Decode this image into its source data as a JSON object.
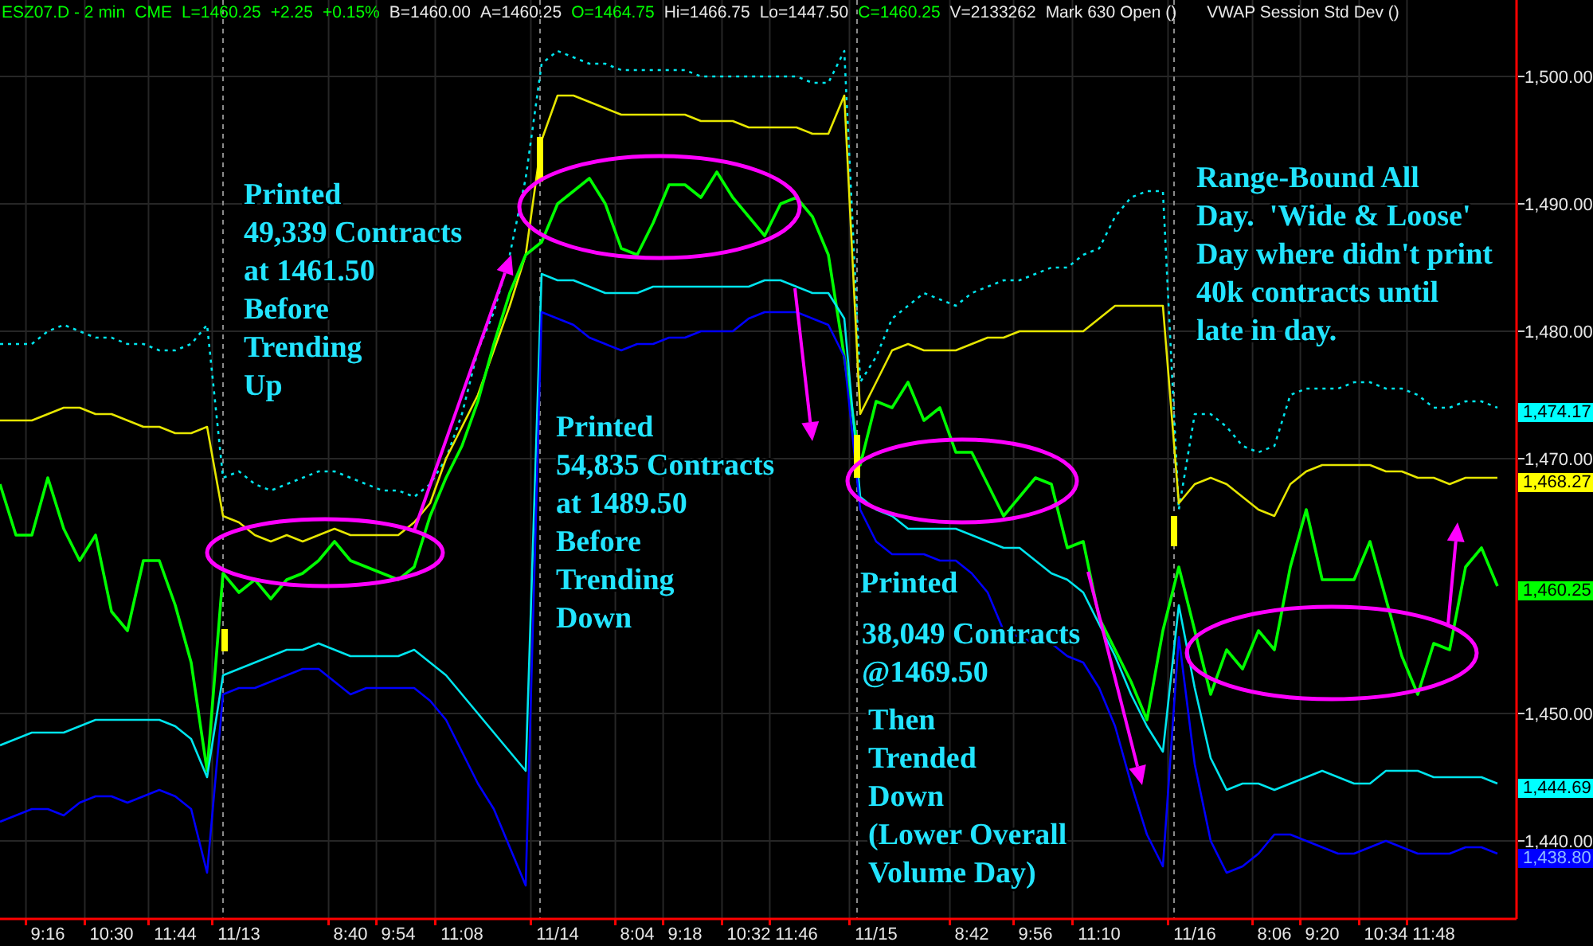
{
  "header": {
    "quote": [
      {
        "text": "ESZ07.D - 2 min",
        "color": "#00ff00"
      },
      {
        "text": "CME",
        "color": "#00ff00"
      },
      {
        "text": "L=1460.25",
        "color": "#00ff00"
      },
      {
        "text": "+2.25",
        "color": "#00ff00"
      },
      {
        "text": "+0.15%",
        "color": "#00ff00"
      },
      {
        "text": "B=1460.00",
        "color": "#e8e8e8"
      },
      {
        "text": "A=1460.25",
        "color": "#e8e8e8"
      },
      {
        "text": "O=1464.75",
        "color": "#00ff00"
      },
      {
        "text": "Hi=1466.75",
        "color": "#e8e8e8"
      },
      {
        "text": "Lo=1447.50",
        "color": "#e8e8e8"
      },
      {
        "text": "C=1460.25",
        "color": "#00ff00"
      },
      {
        "text": "V=2133262",
        "color": "#e8e8e8"
      },
      {
        "text": "Mark 630 Open ()",
        "color": "#e8e8e8"
      }
    ],
    "study": "VWAP Session Std Dev ()"
  },
  "plot": {
    "chart_data": {
      "type": "line",
      "grid": true,
      "categories": [
        null,
        null,
        null,
        "9:16",
        null,
        null,
        null,
        "10:30",
        null,
        null,
        null,
        "11:44",
        null,
        null,
        null,
        "11/13",
        null,
        null,
        null,
        null,
        null,
        null,
        "8:40",
        null,
        null,
        "9:54",
        null,
        null,
        null,
        "11:08",
        null,
        null,
        null,
        null,
        null,
        "11/14",
        null,
        null,
        null,
        null,
        "8:04",
        null,
        null,
        "9:18",
        null,
        null,
        null,
        "10:32",
        null,
        null,
        "11:46",
        null,
        null,
        null,
        null,
        "11/15",
        null,
        null,
        null,
        null,
        null,
        "8:42",
        null,
        null,
        null,
        "9:56",
        null,
        null,
        null,
        "11:10",
        null,
        null,
        null,
        null,
        null,
        "11/16",
        null,
        null,
        null,
        null,
        "8:06",
        null,
        null,
        "9:20",
        null,
        null,
        null,
        "10:34",
        null,
        null,
        "11:48",
        null,
        null,
        null,
        null
      ],
      "ylim": [
        1433.875,
        1506
      ],
      "yticks": [
        {
          "value": 1500,
          "label": "1,500.00"
        },
        {
          "value": 1490,
          "label": "1,490.00"
        },
        {
          "value": 1480,
          "label": "1,480.00"
        },
        {
          "value": 1470,
          "label": "1,470.00"
        },
        {
          "value": 1450,
          "label": "1,450.00"
        },
        {
          "value": 1440,
          "label": "1,440.00"
        }
      ],
      "series": [
        {
          "color": "#00e5ee",
          "line_style": "dotted",
          "values": [
            1479,
            1479,
            1479,
            1480,
            1480.5,
            1480,
            1479.5,
            1479.5,
            1479,
            1479,
            1478.5,
            1478.5,
            1479,
            1480.5,
            1468.5,
            1469,
            1468,
            1467.5,
            1468,
            1468.5,
            1469,
            1469,
            1468.5,
            1468,
            1467.5,
            1467.5,
            1467,
            1468,
            1470,
            1473.5,
            1478.5,
            1481.5,
            1486,
            1492,
            1501,
            1502,
            1501.5,
            1501,
            1501,
            1500.5,
            1500.5,
            1500.5,
            1500.5,
            1500.5,
            1500,
            1500,
            1500,
            1500,
            1500,
            1500,
            1500,
            1499.5,
            1499.5,
            1502,
            1476,
            1478,
            1481,
            1482,
            1483,
            1482.5,
            1482,
            1483,
            1483.5,
            1484,
            1484,
            1484.5,
            1485,
            1485,
            1486,
            1486.5,
            1489,
            1490.5,
            1491,
            1491,
            1466,
            1473.5,
            1473.5,
            1472.5,
            1471,
            1470.5,
            1471,
            1475,
            1475.5,
            1475.5,
            1475.5,
            1476,
            1476,
            1475.5,
            1475.5,
            1475,
            1474,
            1474,
            1474.5,
            1474.5,
            1474
          ]
        },
        {
          "color": "#e6e600",
          "values": [
            1473,
            1473,
            1473,
            1473.5,
            1474,
            1474,
            1473.5,
            1473.5,
            1473,
            1472.5,
            1472.5,
            1472,
            1472,
            1472.5,
            1465.5,
            1465,
            1464,
            1463.5,
            1464,
            1463.5,
            1464,
            1464.5,
            1464,
            1464,
            1464,
            1464,
            1465,
            1466.5,
            1470,
            1472.5,
            1475,
            1478.5,
            1482,
            1486,
            1495,
            1498.5,
            1498.5,
            1498,
            1497.5,
            1497,
            1497,
            1497,
            1497,
            1497,
            1496.5,
            1496.5,
            1496.5,
            1496,
            1496,
            1496,
            1496,
            1495.5,
            1495.5,
            1498.5,
            1473.5,
            1476,
            1478.5,
            1479,
            1478.5,
            1478.5,
            1478.5,
            1479,
            1479.5,
            1479.5,
            1480,
            1480,
            1480,
            1480,
            1480,
            1481,
            1482,
            1482,
            1482,
            1482,
            1466.5,
            1468,
            1468.5,
            1468,
            1467,
            1466,
            1465.5,
            1468,
            1469,
            1469.5,
            1469.5,
            1469.5,
            1469.5,
            1469,
            1469,
            1468.5,
            1468.5,
            1468,
            1468.5,
            1468.5,
            1468.5
          ]
        },
        {
          "color": "#00ff00",
          "values": [
            1468,
            1464,
            1464,
            1468.5,
            1464.5,
            1462,
            1464,
            1458,
            1456.5,
            1462,
            1462,
            1458.5,
            1454,
            1445.5,
            1461,
            1459.5,
            1460.5,
            1459,
            1460.5,
            1461,
            1462,
            1463.5,
            1462,
            1461.5,
            1461,
            1460.5,
            1461.5,
            1465.5,
            1468.5,
            1471,
            1474.5,
            1479,
            1483,
            1486,
            1487,
            1490,
            1491,
            1492,
            1490,
            1486.5,
            1486,
            1488.5,
            1491.5,
            1491.5,
            1490.5,
            1492.5,
            1490.5,
            1489,
            1487.5,
            1490,
            1490.5,
            1489,
            1486,
            1478,
            1469.5,
            1474.5,
            1474,
            1476,
            1473,
            1474,
            1470.5,
            1470.5,
            1468,
            1465.5,
            1467,
            1468.5,
            1468,
            1463,
            1463.5,
            1457.5,
            1455,
            1452.5,
            1449.5,
            1456.5,
            1461.5,
            1456.5,
            1451.5,
            1455,
            1453.5,
            1456.5,
            1455,
            1461.5,
            1466,
            1460.5,
            1460.5,
            1460.5,
            1463.5,
            1459,
            1454.5,
            1451.5,
            1455.5,
            1455,
            1461.5,
            1463,
            1460
          ]
        },
        {
          "color": "#00e5ee",
          "values": [
            1447.5,
            1448,
            1448.5,
            1448.5,
            1448.5,
            1449,
            1449.5,
            1449.5,
            1449.5,
            1449.5,
            1449.5,
            1449,
            1448,
            1445,
            1453,
            1453.5,
            1454,
            1454.5,
            1455,
            1455,
            1455.5,
            1455,
            1454.5,
            1454.5,
            1454.5,
            1454.5,
            1455,
            1454,
            1453,
            1451.5,
            1450,
            1448.5,
            1447,
            1445.5,
            1484.5,
            1484,
            1484,
            1483.5,
            1483,
            1483,
            1483,
            1483.5,
            1483.5,
            1483.5,
            1483.5,
            1483.5,
            1483.5,
            1483.5,
            1484,
            1484,
            1483.5,
            1483,
            1483,
            1481,
            1467,
            1466,
            1465.5,
            1464.5,
            1464.5,
            1464.5,
            1464.5,
            1464,
            1463.5,
            1463,
            1463,
            1462,
            1461,
            1460.5,
            1459.5,
            1457,
            1454.5,
            1451.5,
            1449,
            1447,
            1458.5,
            1452,
            1446.5,
            1444,
            1444.5,
            1444.5,
            1444,
            1444.5,
            1445,
            1445.5,
            1445,
            1444.5,
            1444.5,
            1445.5,
            1445.5,
            1445.5,
            1445,
            1445,
            1445,
            1445,
            1444.5
          ]
        },
        {
          "color": "#0000ff",
          "values": [
            1441.5,
            1442,
            1442.5,
            1442.5,
            1442,
            1443,
            1443.5,
            1443.5,
            1443,
            1443.5,
            1444,
            1443.5,
            1442.5,
            1437.5,
            1451.5,
            1452,
            1452,
            1452.5,
            1453,
            1453.5,
            1453.5,
            1452.5,
            1451.5,
            1452,
            1452,
            1452,
            1452,
            1451,
            1449.5,
            1447,
            1444.5,
            1442.5,
            1439.5,
            1436.5,
            1481.5,
            1481,
            1480.5,
            1479.5,
            1479,
            1478.5,
            1479,
            1479,
            1479.5,
            1479.5,
            1480,
            1480,
            1480,
            1481,
            1481.5,
            1481.5,
            1481.5,
            1481,
            1480.5,
            1478,
            1466,
            1463.5,
            1462.5,
            1462.5,
            1462.5,
            1462,
            1462,
            1461,
            1459.5,
            1456.5,
            1456,
            1455.5,
            1455.5,
            1454.5,
            1454,
            1452,
            1449,
            1444.5,
            1440.5,
            1438,
            1456,
            1446,
            1440,
            1437.5,
            1438,
            1439,
            1440.5,
            1440.5,
            1440,
            1439.5,
            1439,
            1439,
            1439.5,
            1440,
            1439.5,
            1439,
            1439,
            1439,
            1439.5,
            1439.5,
            1439
          ]
        }
      ],
      "annotations": [
        "Printed\n49,339 Contracts\nat 1461.50\nBefore\nTrending\nUp",
        "Printed\n54,835 Contracts\nat 1489.50\nBefore\nTrending\nDown",
        "Printed",
        "38,049 Contracts\n@1469.50",
        "Then\nTrended\nDown\n(Lower Overall\nVolume Day)",
        "Range-Bound All\nDay.  'Wide & Loose'\nDay where didn't print\n40k contracts until\nlate in day."
      ]
    },
    "price_tags": [
      {
        "text": "1,474.17",
        "color": "#00ffff"
      },
      {
        "text": "1,468.27",
        "color": "#ffff00"
      },
      {
        "text": "1,460.25",
        "color": "#00ff00"
      },
      {
        "text": "1,444.69",
        "color": "#00ffff"
      },
      {
        "text": "1,438.80",
        "color": "#0000ff"
      }
    ]
  }
}
